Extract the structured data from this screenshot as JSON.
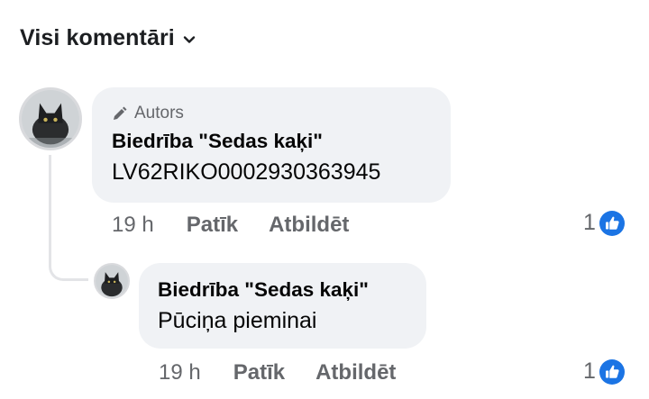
{
  "filter": {
    "label": "Visi komentāri"
  },
  "comments": [
    {
      "badge": "Autors",
      "author": "Biedrība \"Sedas kaķi\"",
      "text": "LV62RIKO0002930363945",
      "time": "19 h",
      "like_label": "Patīk",
      "reply_label": "Atbildēt",
      "reaction_count": "1"
    },
    {
      "author": "Biedrība \"Sedas kaķi\"",
      "text": "Pūciņa pieminai",
      "time": "19 h",
      "like_label": "Patīk",
      "reply_label": "Atbildēt",
      "reaction_count": "1"
    }
  ],
  "colors": {
    "like_blue": "#1b74e4",
    "bubble": "#f0f2f5",
    "meta": "#65676b"
  },
  "icons": [
    "chevron-down-icon",
    "pencil-icon",
    "like-thumb-icon",
    "avatar-cat"
  ]
}
